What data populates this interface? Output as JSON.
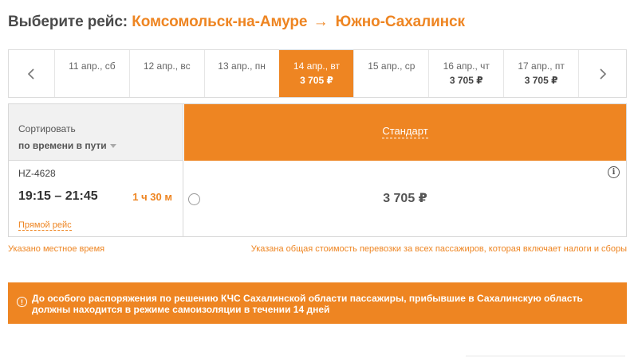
{
  "header": {
    "prefix": "Выберите рейс:",
    "origin": "Комсомольск-на-Амуре",
    "arrow": "→",
    "destination": "Южно-Сахалинск"
  },
  "dates": [
    {
      "label": "11 апр., сб",
      "price": ""
    },
    {
      "label": "12 апр., вс",
      "price": ""
    },
    {
      "label": "13 апр., пн",
      "price": ""
    },
    {
      "label": "14 апр., вт",
      "price": "3 705 ₽",
      "selected": true
    },
    {
      "label": "15 апр., ср",
      "price": ""
    },
    {
      "label": "16 апр., чт",
      "price": "3 705 ₽"
    },
    {
      "label": "17 апр., пт",
      "price": "3 705 ₽"
    }
  ],
  "sort": {
    "label": "Сортировать",
    "value": "по времени в пути"
  },
  "fare": {
    "name": "Стандарт"
  },
  "flight": {
    "number": "HZ-4628",
    "times": "19:15 – 21:45",
    "duration": "1 ч 30 м",
    "direct": "Прямой рейс",
    "price": "3 705 ₽"
  },
  "notes": {
    "local_time": "Указано местное время",
    "total_cost": "Указана общая стоимость перевозки за всех пассажиров, которая включает налоги и сборы"
  },
  "alert": {
    "text": "До особого распоряжения по решению КЧС Сахалинской области пассажиры, прибывшие в Сахалинскую область должны находится в режиме самоизоляции в течении 14 дней"
  },
  "colors": {
    "accent": "#ee8522"
  },
  "icons": {
    "prev": "chevron-left-icon",
    "next": "chevron-right-icon",
    "info": "info-icon",
    "alert": "alert-info-icon",
    "sort": "caret-down-icon"
  }
}
